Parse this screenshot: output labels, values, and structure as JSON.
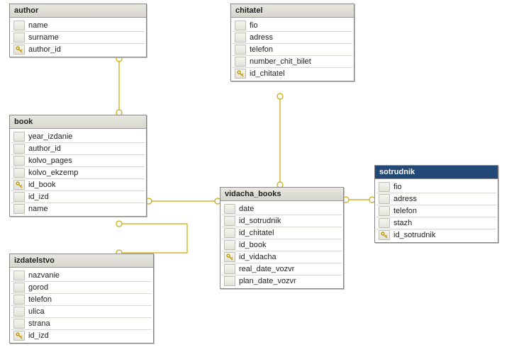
{
  "entities": {
    "author": {
      "title": "author",
      "columns": [
        {
          "name": "name",
          "pk": false
        },
        {
          "name": "surname",
          "pk": false
        },
        {
          "name": "author_id",
          "pk": true
        }
      ]
    },
    "chitatel": {
      "title": "chitatel",
      "columns": [
        {
          "name": "fio",
          "pk": false
        },
        {
          "name": "adress",
          "pk": false
        },
        {
          "name": "telefon",
          "pk": false
        },
        {
          "name": "number_chit_bilet",
          "pk": false
        },
        {
          "name": "id_chitatel",
          "pk": true
        }
      ]
    },
    "book": {
      "title": "book",
      "columns": [
        {
          "name": "year_izdanie",
          "pk": false
        },
        {
          "name": "author_id",
          "pk": false
        },
        {
          "name": "kolvo_pages",
          "pk": false
        },
        {
          "name": "kolvo_ekzemp",
          "pk": false
        },
        {
          "name": "id_book",
          "pk": true
        },
        {
          "name": "id_izd",
          "pk": false
        },
        {
          "name": "name",
          "pk": false
        }
      ]
    },
    "sotrudnik": {
      "title": "sotrudnik",
      "selected": true,
      "columns": [
        {
          "name": "fio",
          "pk": false
        },
        {
          "name": "adress",
          "pk": false
        },
        {
          "name": "telefon",
          "pk": false
        },
        {
          "name": "stazh",
          "pk": false
        },
        {
          "name": "id_sotrudnik",
          "pk": true
        }
      ]
    },
    "vidacha_books": {
      "title": "vidacha_books",
      "columns": [
        {
          "name": "date",
          "pk": false
        },
        {
          "name": "id_sotrudnik",
          "pk": false
        },
        {
          "name": "id_chitatel",
          "pk": false
        },
        {
          "name": "id_book",
          "pk": false
        },
        {
          "name": "id_vidacha",
          "pk": true
        },
        {
          "name": "real_date_vozvr",
          "pk": false
        },
        {
          "name": "plan_date_vozvr",
          "pk": false
        }
      ]
    },
    "izdatelstvo": {
      "title": "izdatelstvo",
      "columns": [
        {
          "name": "nazvanie",
          "pk": false
        },
        {
          "name": "gorod",
          "pk": false
        },
        {
          "name": "telefon",
          "pk": false
        },
        {
          "name": "ulica",
          "pk": false
        },
        {
          "name": "strana",
          "pk": false
        },
        {
          "name": "id_izd",
          "pk": true
        }
      ]
    }
  },
  "relationships": [
    {
      "from": "author.author_id",
      "to": "book.author_id"
    },
    {
      "from": "chitatel.id_chitatel",
      "to": "vidacha_books.id_chitatel"
    },
    {
      "from": "book.id_book",
      "to": "vidacha_books.id_book"
    },
    {
      "from": "sotrudnik.id_sotrudnik",
      "to": "vidacha_books.id_sotrudnik"
    },
    {
      "from": "izdatelstvo.id_izd",
      "to": "book.id_izd"
    }
  ],
  "chart_data": {
    "type": "table",
    "title": "ER Diagram — library database schema",
    "nodes": [
      "author",
      "chitatel",
      "book",
      "sotrudnik",
      "vidacha_books",
      "izdatelstvo"
    ],
    "edges": [
      [
        "author",
        "book"
      ],
      [
        "chitatel",
        "vidacha_books"
      ],
      [
        "book",
        "vidacha_books"
      ],
      [
        "sotrudnik",
        "vidacha_books"
      ],
      [
        "izdatelstvo",
        "book"
      ]
    ]
  }
}
